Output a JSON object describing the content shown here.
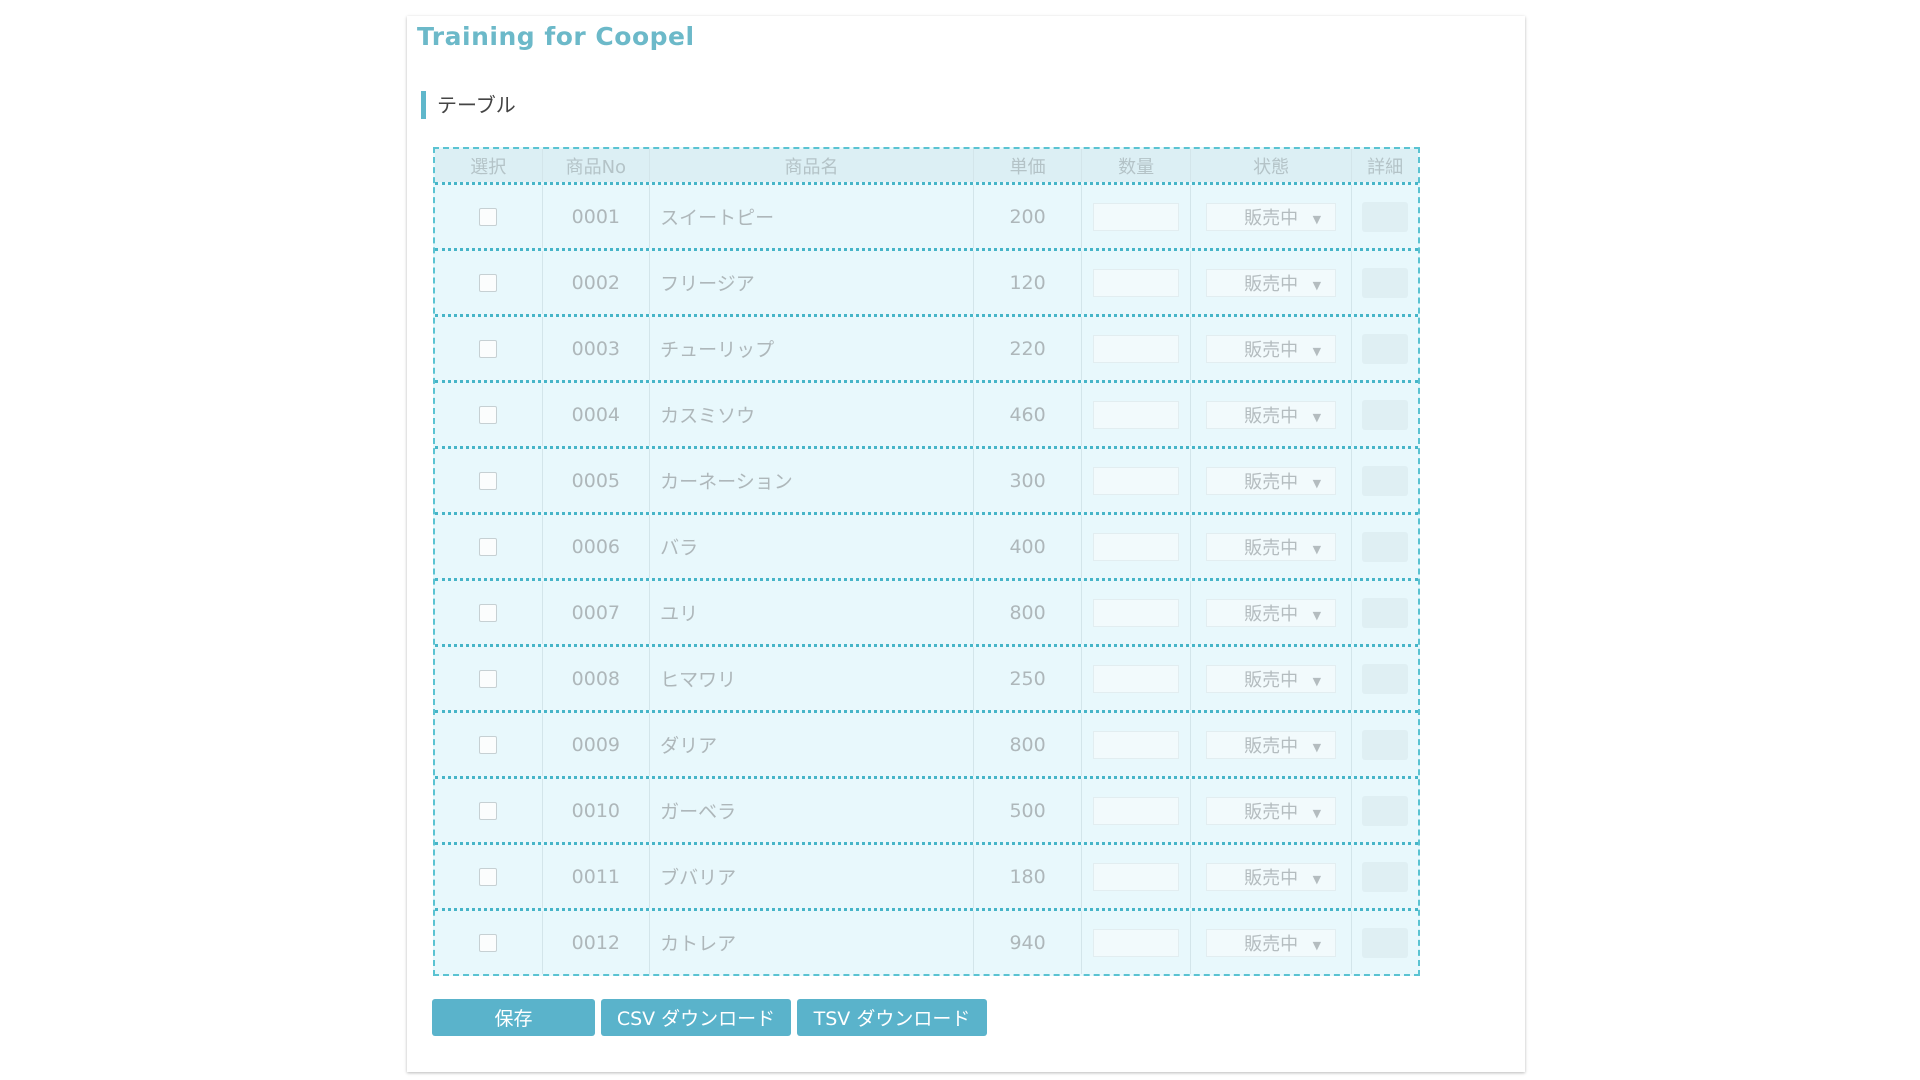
{
  "app": {
    "title": "Training for Coopel"
  },
  "section": {
    "heading": "テーブル"
  },
  "table": {
    "columns": [
      "選択",
      "商品No",
      "商品名",
      "単価",
      "数量",
      "状態",
      "詳細"
    ],
    "rows": [
      {
        "no": "0001",
        "name": "スイートピー",
        "price": "200",
        "status": "販売中"
      },
      {
        "no": "0002",
        "name": "フリージア",
        "price": "120",
        "status": "販売中"
      },
      {
        "no": "0003",
        "name": "チューリップ",
        "price": "220",
        "status": "販売中"
      },
      {
        "no": "0004",
        "name": "カスミソウ",
        "price": "460",
        "status": "販売中"
      },
      {
        "no": "0005",
        "name": "カーネーション",
        "price": "300",
        "status": "販売中"
      },
      {
        "no": "0006",
        "name": "バラ",
        "price": "400",
        "status": "販売中"
      },
      {
        "no": "0007",
        "name": "ユリ",
        "price": "800",
        "status": "販売中"
      },
      {
        "no": "0008",
        "name": "ヒマワリ",
        "price": "250",
        "status": "販売中"
      },
      {
        "no": "0009",
        "name": "ダリア",
        "price": "800",
        "status": "販売中"
      },
      {
        "no": "0010",
        "name": "ガーベラ",
        "price": "500",
        "status": "販売中"
      },
      {
        "no": "0011",
        "name": "ブバリア",
        "price": "180",
        "status": "販売中"
      },
      {
        "no": "0012",
        "name": "カトレア",
        "price": "940",
        "status": "販売中"
      }
    ]
  },
  "buttons": {
    "save": "保存",
    "csv": "CSV ダウンロード",
    "tsv": "TSV ダウンロード"
  },
  "icons": {
    "status_caret": "▼"
  },
  "colors": {
    "title": "#6cb9c9",
    "accent": "#5ab3cb",
    "grid_border": "#5ac3d2",
    "grid_bg": "#e8f8fc"
  }
}
